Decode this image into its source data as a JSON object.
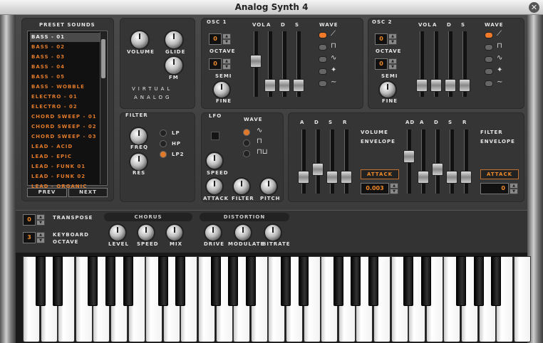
{
  "window": {
    "title": "Analog Synth 4",
    "close_glyph": "✕"
  },
  "preset_sounds": {
    "title": "PRESET SOUNDS",
    "items": [
      "BASS - 01",
      "BASS - 02",
      "BASS - 03",
      "BASS - 04",
      "BASS - 05",
      "BASS - WOBBLE",
      "ELECTRO - 01",
      "ELECTRO - 02",
      "CHORD SWEEP - 01",
      "CHORD SWEEP - 02",
      "CHORD SWEEP - 03",
      "LEAD - ACID",
      "LEAD - EPIC",
      "LEAD - FUNK 01",
      "LEAD - FUNK 02",
      "LEAD - ORGANIC"
    ],
    "selected": 0,
    "prev_label": "PREV",
    "next_label": "NEXT"
  },
  "master": {
    "volume": "VOLUME",
    "glide": "GLIDE",
    "fm": "FM",
    "logo_line1": "VIRTUAL",
    "logo_line2": "ANALOG"
  },
  "osc1": {
    "title": "OSC 1",
    "octave_value": "0",
    "octave_label": "OCTAVE",
    "semi_value": "0",
    "semi_label": "SEMI",
    "fine_label": "FINE",
    "wave_title": "WAVE",
    "faders": [
      {
        "label": "VOL",
        "level": 0.55
      },
      {
        "label": "A",
        "level": 0.1
      },
      {
        "label": "D",
        "level": 0.1
      },
      {
        "label": "S",
        "level": 0.1
      }
    ],
    "active_wave": 0
  },
  "osc2": {
    "title": "OSC 2",
    "octave_value": "0",
    "octave_label": "OCTAVE",
    "semi_value": "0",
    "semi_label": "SEMI",
    "fine_label": "FINE",
    "wave_title": "WAVE",
    "faders": [
      {
        "label": "VOL",
        "level": 0.1
      },
      {
        "label": "A",
        "level": 0.1
      },
      {
        "label": "D",
        "level": 0.1
      },
      {
        "label": "S",
        "level": 0.1
      }
    ],
    "active_wave": 0
  },
  "wave_icons": [
    "sawtooth-wave-icon",
    "square-wave-icon",
    "sine-wave-icon",
    "noise-wave-icon",
    "triangle-wave-icon"
  ],
  "filter": {
    "title": "FILTER",
    "freq": "FREQ",
    "res": "RES",
    "modes": [
      "LP",
      "HP",
      "LP2"
    ],
    "active_mode": 2
  },
  "lfo": {
    "title": "LFO",
    "wave_title": "WAVE",
    "speed": "SPEED",
    "attack": "ATTACK",
    "filter": "FILTER",
    "pitch": "PITCH",
    "active_wave": 0
  },
  "vol_env": {
    "faders": [
      {
        "label": "A",
        "level": 0.2
      },
      {
        "label": "D",
        "level": 0.35
      },
      {
        "label": "S",
        "level": 0.2
      },
      {
        "label": "R",
        "level": 0.2
      }
    ],
    "label1": "VOLUME",
    "label2": "ENVELOPE",
    "attack_btn": "ATTACK",
    "attack_value": "0.003"
  },
  "filt_env": {
    "faders": [
      {
        "label": "AD",
        "level": 0.6
      },
      {
        "label": "A",
        "level": 0.2
      },
      {
        "label": "D",
        "level": 0.35
      },
      {
        "label": "S",
        "level": 0.2
      },
      {
        "label": "R",
        "level": 0.2
      }
    ],
    "label1": "FILTER",
    "label2": "ENVELOPE",
    "attack_btn": "ATTACK",
    "attack_value": "0"
  },
  "transpose": {
    "label": "TRANSPOSE",
    "value": "0"
  },
  "keyboard_octave": {
    "label1": "KEYBOARD",
    "label2": "OCTAVE",
    "value": "3"
  },
  "chorus": {
    "title": "CHORUS",
    "level": "LEVEL",
    "speed": "SPEED",
    "mix": "MIX"
  },
  "distortion": {
    "title": "DISTORTION",
    "drive": "DRIVE",
    "modulate": "MODULATE",
    "bitrate": "BITRATE"
  },
  "colors": {
    "accent": "#f07a2a",
    "panel": "#3b3b3b"
  }
}
